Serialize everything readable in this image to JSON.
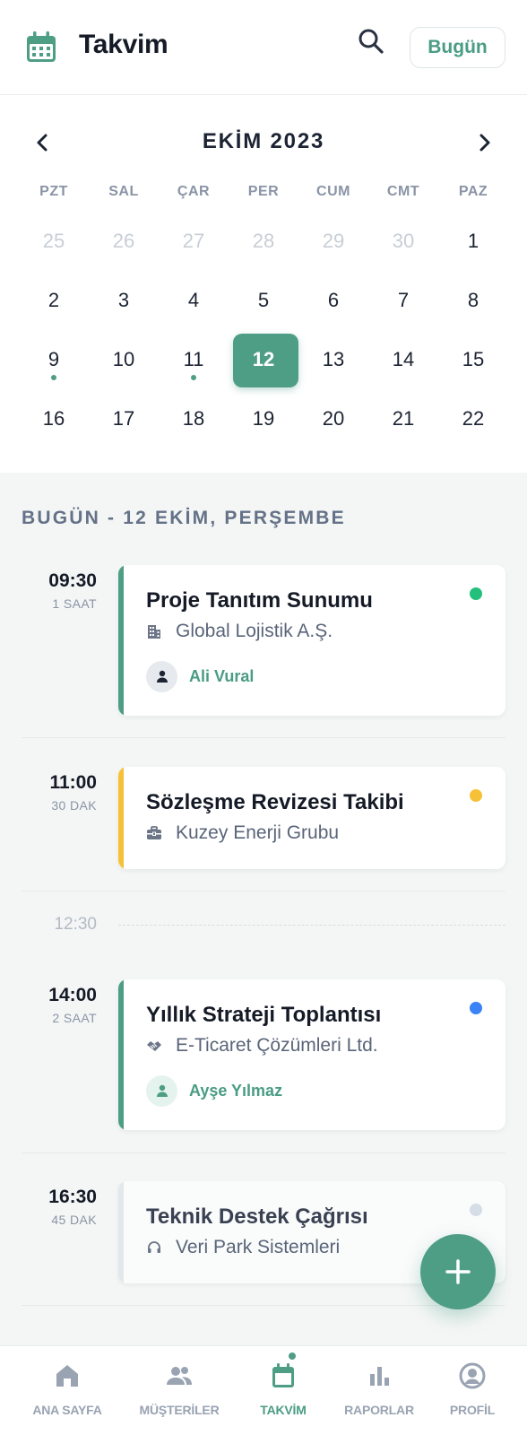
{
  "header": {
    "title": "Takvim",
    "today_button": "Bugün",
    "accent": "#4e9e86",
    "icons": {
      "app": "calendar-icon",
      "search": "search-icon"
    }
  },
  "calendar": {
    "month_label": "EKİM 2023",
    "weekdays": [
      "PZT",
      "SAL",
      "ÇAR",
      "PER",
      "CUM",
      "CMT",
      "PAZ"
    ],
    "selected_day": "12",
    "weeks": [
      [
        "25",
        "26",
        "27",
        "28",
        "29",
        "30",
        "1"
      ],
      [
        "2",
        "3",
        "4",
        "5",
        "6",
        "7",
        "8"
      ],
      [
        "9",
        "10",
        "11",
        "12",
        "13",
        "14",
        "15"
      ],
      [
        "16",
        "17",
        "18",
        "19",
        "20",
        "21",
        "22"
      ]
    ]
  },
  "agenda": {
    "section_title": "BUGÜN - 12 EKİM, PERŞEMBE",
    "events": [
      {
        "time": "09:30",
        "duration": "1 SAAT",
        "title": "Proje Tanıtım Sunumu",
        "company": "Global Lojistik A.Ş.",
        "company_icon": "building-icon",
        "person": "Ali Vural",
        "bar_color": "#4e9e86",
        "status_color": "#22c07a"
      },
      {
        "time": "11:00",
        "duration": "30 DAK",
        "title": "Sözleşme Revizesi Takibi",
        "company": "Kuzey Enerji Grubu",
        "company_icon": "briefcase-icon",
        "bar_color": "#f7c137",
        "status_color": "#f7c137"
      },
      {
        "gap_time": "12:30"
      },
      {
        "time": "14:00",
        "duration": "2 SAAT",
        "title": "Yıllık Strateji Toplantısı",
        "company": "E-Ticaret Çözümleri Ltd.",
        "company_icon": "handshake-icon",
        "person": "Ayşe Yılmaz",
        "bar_color": "#4e9e86",
        "status_color": "#3b82f6"
      },
      {
        "time": "16:30",
        "duration": "45 DAK",
        "title": "Teknik Destek Çağrısı",
        "company": "Veri Park Sistemleri",
        "company_icon": "headset-icon",
        "bar_color": "#e3e8ed",
        "status_color": "#d5dde6"
      }
    ]
  },
  "fab": {
    "icon": "plus-icon"
  },
  "tabbar": {
    "items": [
      {
        "label": "ANA SAYFA",
        "icon": "home-icon"
      },
      {
        "label": "MÜŞTERİLER",
        "icon": "users-icon"
      },
      {
        "label": "TAKVİM",
        "icon": "calendar-icon",
        "active": true
      },
      {
        "label": "RAPORLAR",
        "icon": "bar-chart-icon"
      },
      {
        "label": "PROFİL",
        "icon": "profile-icon"
      }
    ]
  }
}
